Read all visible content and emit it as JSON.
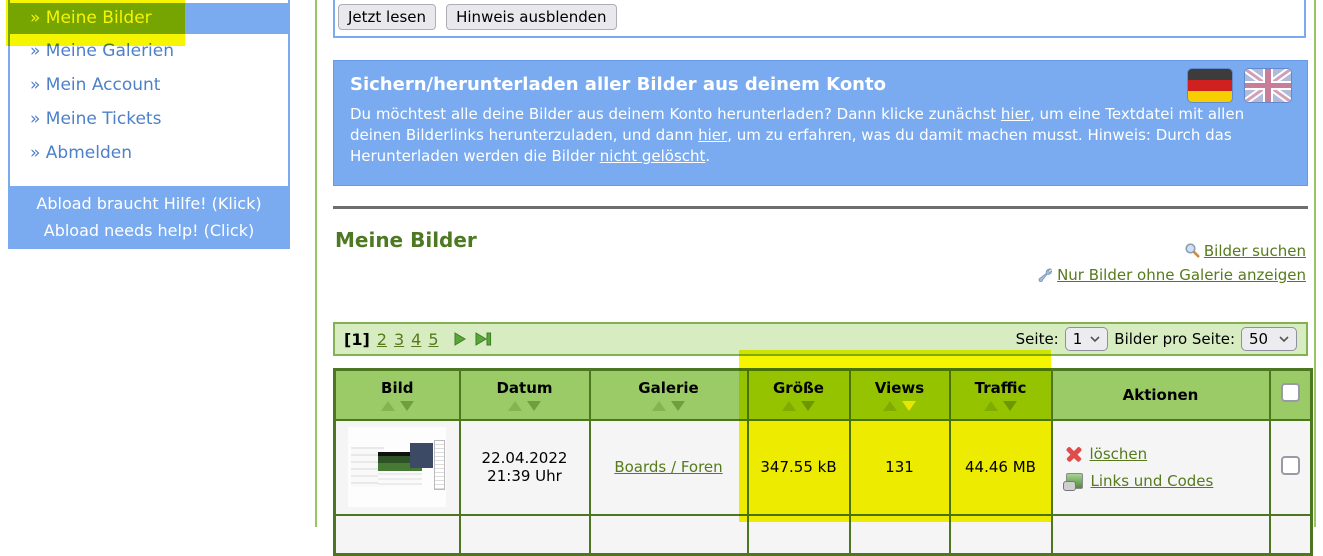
{
  "colors": {
    "accent_blue": "#7aabf0",
    "selected_text_yellow": "#ffff00",
    "link_green": "#567a1c",
    "table_border_green": "#4c7720",
    "header_green": "#9bcb67",
    "pagebar_green": "#d7edc1",
    "highlight_yellow": "#f6f500"
  },
  "sidebar": {
    "selected_item": "» Meine Bilder",
    "items": [
      "» Meine Galerien",
      "» Mein Account",
      "» Meine Tickets",
      "» Abmelden"
    ],
    "help_line_de": "Abload braucht Hilfe! (Klick)",
    "help_line_en": "Abload needs help! (Click)"
  },
  "notice_bar": {
    "read_button": "Jetzt lesen",
    "hide_button": "Hinweis ausblenden"
  },
  "info_box": {
    "title": "Sichern/herunterladen aller Bilder aus deinem Konto",
    "body_1": "Du möchtest alle deine Bilder aus deinem Konto herunterladen? Dann klicke zunächst ",
    "link_1": "hier",
    "body_2": ", um eine Textdatei mit allen deinen Bilderlinks herunterzuladen, und dann ",
    "link_2": "hier",
    "body_3": ", um zu erfahren, was du damit machen musst. Hinweis: Durch das Herunterladen werden die Bilder ",
    "link_3": "nicht gelöscht",
    "body_4": ".",
    "flags": [
      "german-flag",
      "uk-flag"
    ]
  },
  "main": {
    "title": "Meine Bilder",
    "search_link": "Bilder suchen",
    "filter_link": "Nur Bilder ohne Galerie anzeigen"
  },
  "pagination": {
    "current_page": "[1]",
    "pages": [
      "2",
      "3",
      "4",
      "5"
    ],
    "page_label": "Seite:",
    "page_value": "1",
    "per_page_label": "Bilder pro Seite:",
    "per_page_value": "50"
  },
  "table": {
    "headers": [
      {
        "label": "Bild",
        "sortable": true
      },
      {
        "label": "Datum",
        "sortable": true
      },
      {
        "label": "Galerie",
        "sortable": true
      },
      {
        "label": "Größe",
        "sortable": true
      },
      {
        "label": "Views",
        "sortable": true,
        "active_sort": "desc"
      },
      {
        "label": "Traffic",
        "sortable": true
      },
      {
        "label": "Aktionen",
        "sortable": false
      }
    ],
    "row": {
      "date": "22.04.2022",
      "time": "21:39 Uhr",
      "gallery": "Boards / Foren",
      "size": "347.55 kB",
      "views": "131",
      "traffic": "44.46 MB",
      "delete_label": "löschen",
      "codes_label": "Links und Codes"
    }
  }
}
